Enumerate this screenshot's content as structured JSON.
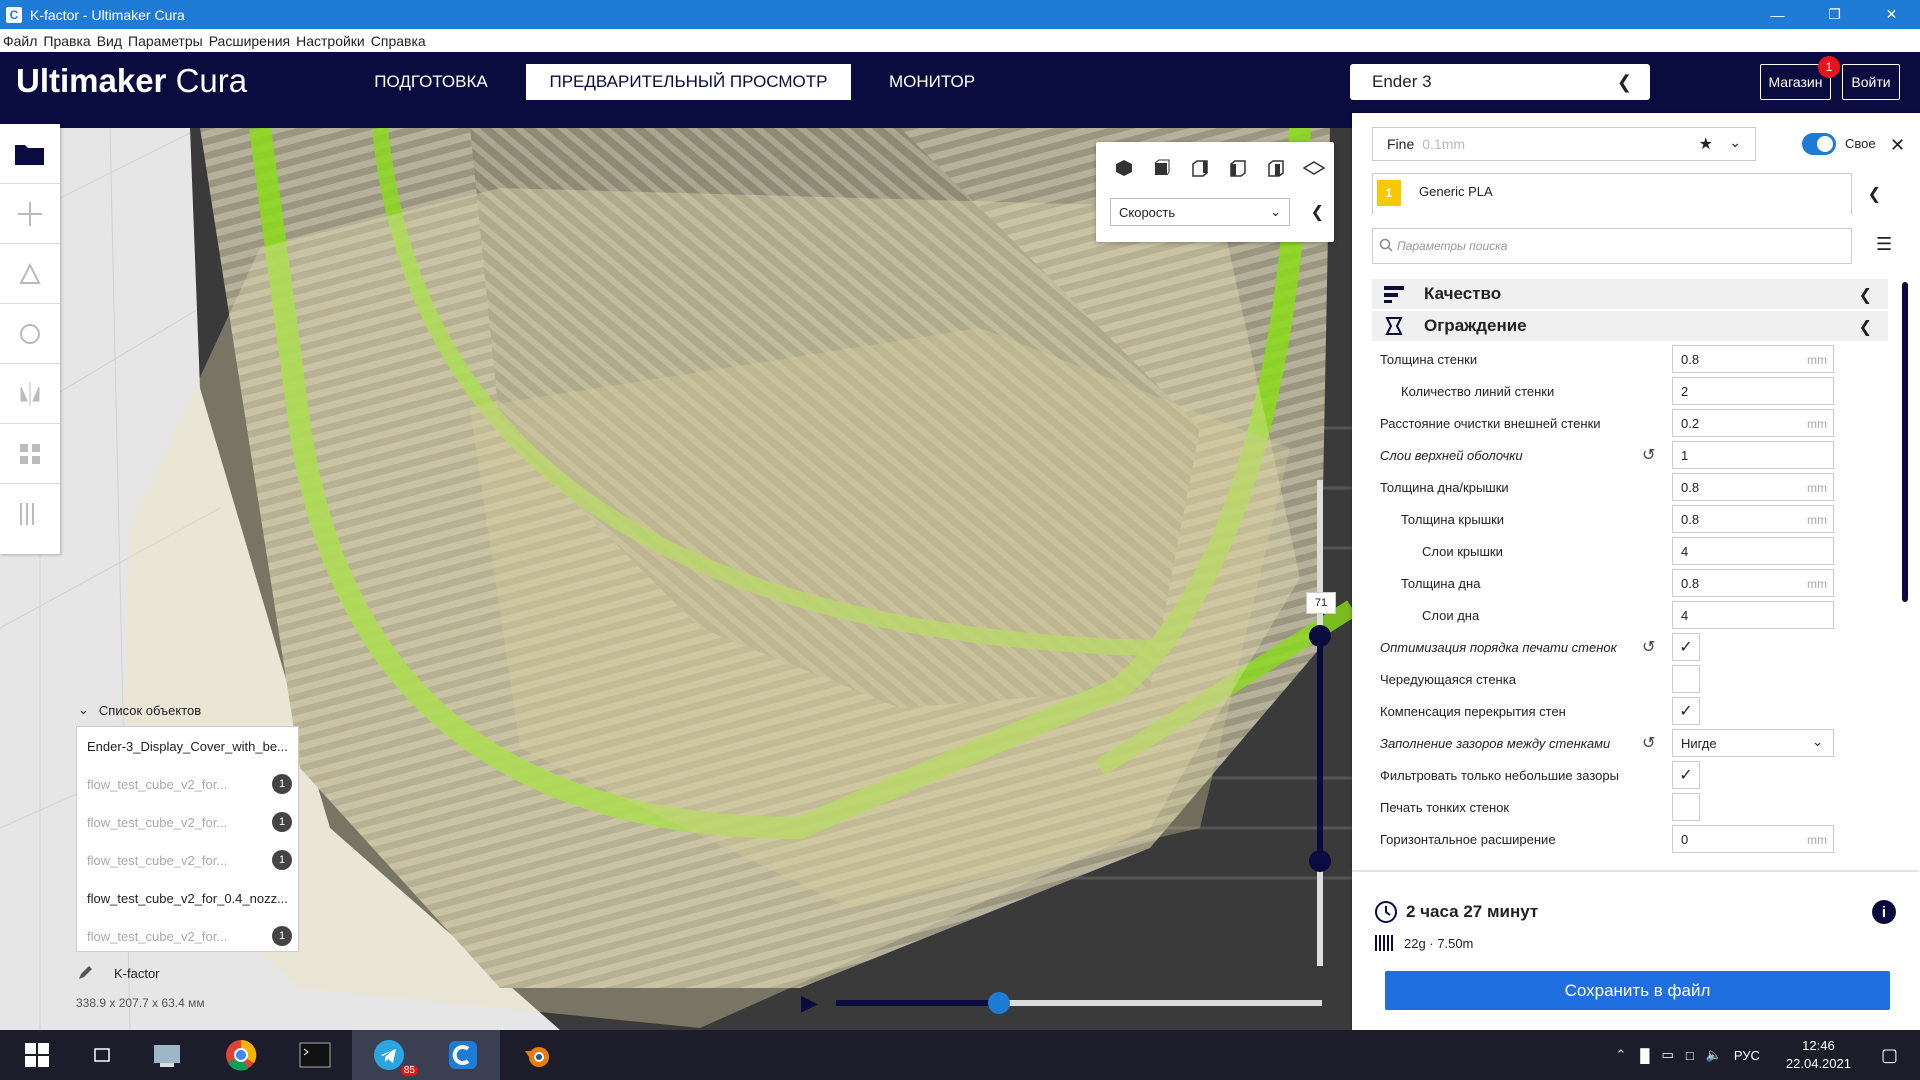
{
  "window": {
    "title": "K-factor - Ultimaker Cura",
    "app_icon": "C"
  },
  "menu": [
    "Файл",
    "Правка",
    "Вид",
    "Параметры",
    "Расширения",
    "Настройки",
    "Справка"
  ],
  "header": {
    "logo_bold": "Ultimaker",
    "logo_light": "Cura",
    "tabs": [
      "ПОДГОТОВКА",
      "ПРЕДВАРИТЕЛЬНЫЙ ПРОСМОТР",
      "МОНИТОР"
    ],
    "printer": "Ender 3",
    "marketplace": "Магазин",
    "marketplace_badge": "1",
    "signin": "Войти"
  },
  "view_panel": {
    "color_scheme": "Скорость"
  },
  "object_list": {
    "title": "Список объектов",
    "items": [
      {
        "name": "Ender-3_Display_Cover_with_be...",
        "count": ""
      },
      {
        "name": "flow_test_cube_v2_for...",
        "count": "1"
      },
      {
        "name": "flow_test_cube_v2_for...",
        "count": "1"
      },
      {
        "name": "flow_test_cube_v2_for...",
        "count": "1"
      },
      {
        "name": "flow_test_cube_v2_for_0.4_nozz...",
        "count": ""
      },
      {
        "name": "flow_test_cube_v2_for...",
        "count": "1"
      }
    ],
    "job_name": "K-factor",
    "dimensions": "338.9 x 207.7 x 63.4 мм"
  },
  "layer_slider": {
    "value": "71"
  },
  "settings": {
    "profile": "Fine",
    "profile_sub": "0.1mm",
    "custom_label": "Свое",
    "material_extruder": "1",
    "material": "Generic PLA",
    "search_placeholder": "Параметры поиска",
    "categories": [
      "Качество",
      "Ограждение"
    ],
    "rows": [
      {
        "label": "Толщина стенки",
        "value": "0.8",
        "unit": "mm"
      },
      {
        "label": "Количество линий стенки",
        "value": "2",
        "unit": ""
      },
      {
        "label": "Расстояние очистки внешней стенки",
        "value": "0.2",
        "unit": "mm"
      },
      {
        "label": "Слои верхней оболочки",
        "value": "1",
        "unit": ""
      },
      {
        "label": "Толщина дна/крышки",
        "value": "0.8",
        "unit": "mm"
      },
      {
        "label": "Толщина крышки",
        "value": "0.8",
        "unit": "mm"
      },
      {
        "label": "Слои крышки",
        "value": "4",
        "unit": ""
      },
      {
        "label": "Толщина дна",
        "value": "0.8",
        "unit": "mm"
      },
      {
        "label": "Слои дна",
        "value": "4",
        "unit": ""
      },
      {
        "label": "Оптимизация порядка печати стенок",
        "value": "✓",
        "unit": ""
      },
      {
        "label": "Чередующаяся стенка",
        "value": "",
        "unit": ""
      },
      {
        "label": "Компенсация перекрытия стен",
        "value": "✓",
        "unit": ""
      },
      {
        "label": "Заполнение зазоров между стенками",
        "value": "Нигде",
        "unit": ""
      },
      {
        "label": "Фильтровать только небольшие зазоры",
        "value": "✓",
        "unit": ""
      },
      {
        "label": "Печать тонких стенок",
        "value": "",
        "unit": ""
      },
      {
        "label": "Горизонтальное расширение",
        "value": "0",
        "unit": "mm"
      }
    ]
  },
  "estimate": {
    "time": "2 часа 27 минут",
    "usage": "22g · 7.50m",
    "save": "Сохранить в файл"
  },
  "taskbar": {
    "lang": "РУС",
    "time": "12:46",
    "date": "22.04.2021",
    "telegram_badge": "85"
  }
}
